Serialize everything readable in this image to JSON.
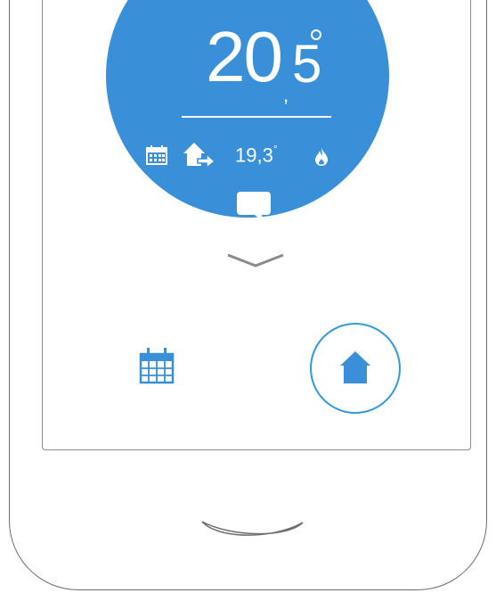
{
  "thermostat": {
    "temperature_whole": "20",
    "temperature_separator": ",",
    "temperature_decimal": "5",
    "status_temperature": "19,3",
    "status_degree_symbol": "°"
  },
  "colors": {
    "accent": "#3a8fd9",
    "selection_ring": "#2e9ad6",
    "frame": "#6d6d6d"
  },
  "icons": {
    "status": [
      "calendar-icon",
      "home-away-icon",
      "flame-icon"
    ],
    "message": "message-icon",
    "expand": "chevron-down-icon"
  },
  "bottom_nav": {
    "items": [
      "calendar-icon",
      "home-icon"
    ],
    "selected": "home-icon"
  }
}
